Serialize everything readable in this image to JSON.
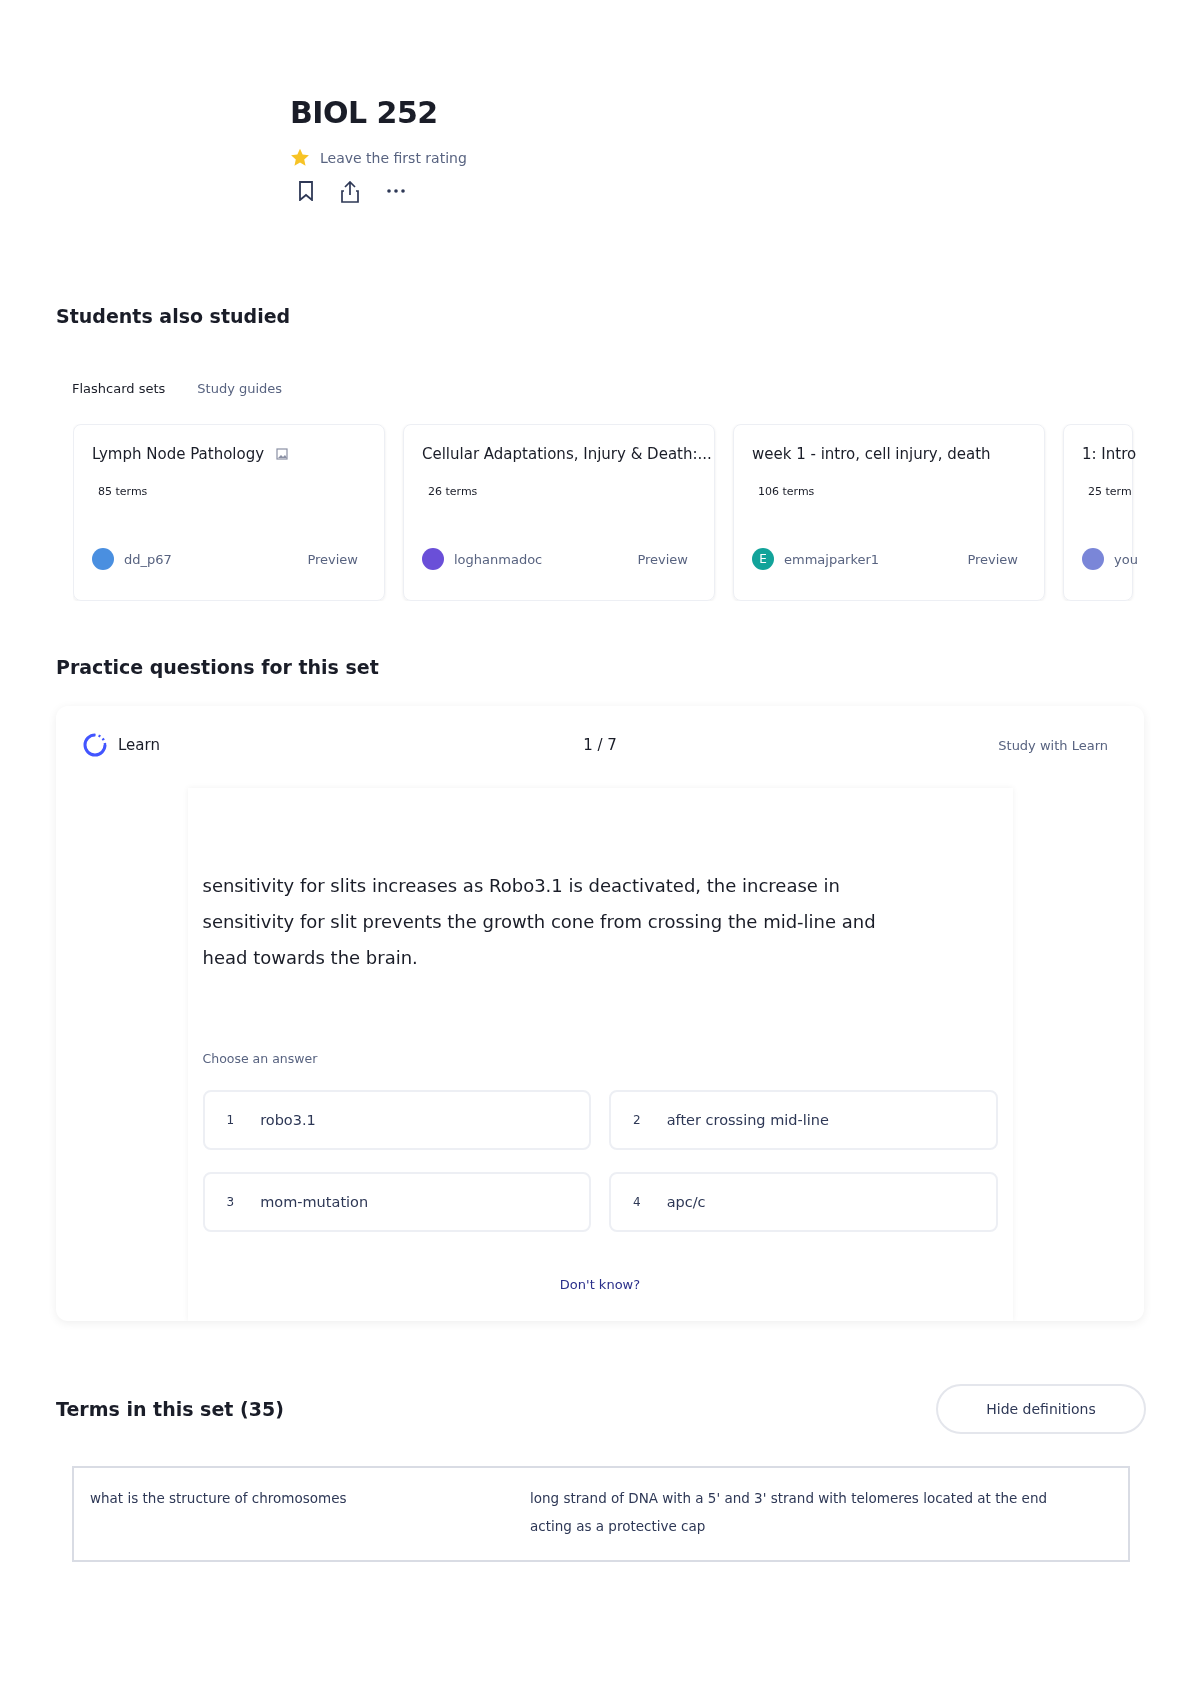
{
  "set": {
    "title": "BIOL 252",
    "rating_text": "Leave the first rating"
  },
  "students_also_studied": {
    "heading": "Students also studied",
    "tabs": [
      {
        "label": "Flashcard sets",
        "selected": true
      },
      {
        "label": "Study guides",
        "selected": false
      }
    ],
    "cards": [
      {
        "title": "Lymph Node Pathology",
        "image_icon": true,
        "terms": "85 terms",
        "author": "dd_p67",
        "color": "#4a8fe0",
        "preview": "Preview"
      },
      {
        "title": "Cellular Adaptations, Injury & Death:...",
        "terms": "26 terms",
        "author": "loghanmadoc",
        "color": "#6a4fd8",
        "preview": "Preview"
      },
      {
        "title": "week 1 - intro, cell injury, death",
        "terms": "106 terms",
        "author": "emmajparker1",
        "avatar_letter": "E",
        "color": "#12a39a",
        "preview": "Preview"
      },
      {
        "title": "1: Intro",
        "terms": "25 term",
        "author": "you",
        "color": "#7a86d8"
      }
    ]
  },
  "practice": {
    "heading": "Practice questions for this set",
    "mode": "Learn",
    "progress": "1 / 7",
    "study_link": "Study with Learn",
    "question": "sensitivity for slits increases as Robo3.1 is deactivated, the increase in sensitivity for slit prevents the growth cone from crossing the mid-line and head towards the brain.",
    "prompt": "Choose an answer",
    "answers": [
      {
        "number": "1",
        "text": "robo3.1"
      },
      {
        "number": "2",
        "text": "after crossing mid-line"
      },
      {
        "number": "3",
        "text": "mom-mutation"
      },
      {
        "number": "4",
        "text": "apc/c"
      }
    ],
    "dont_know": "Don't know?"
  },
  "terms": {
    "heading": "Terms in this set (35)",
    "toggle_button": "Hide definitions",
    "rows": [
      {
        "term": "what is the structure of chromosomes",
        "definition": "long strand of DNA with a 5' and 3' strand with telomeres located at the end acting as a protective cap"
      }
    ]
  }
}
